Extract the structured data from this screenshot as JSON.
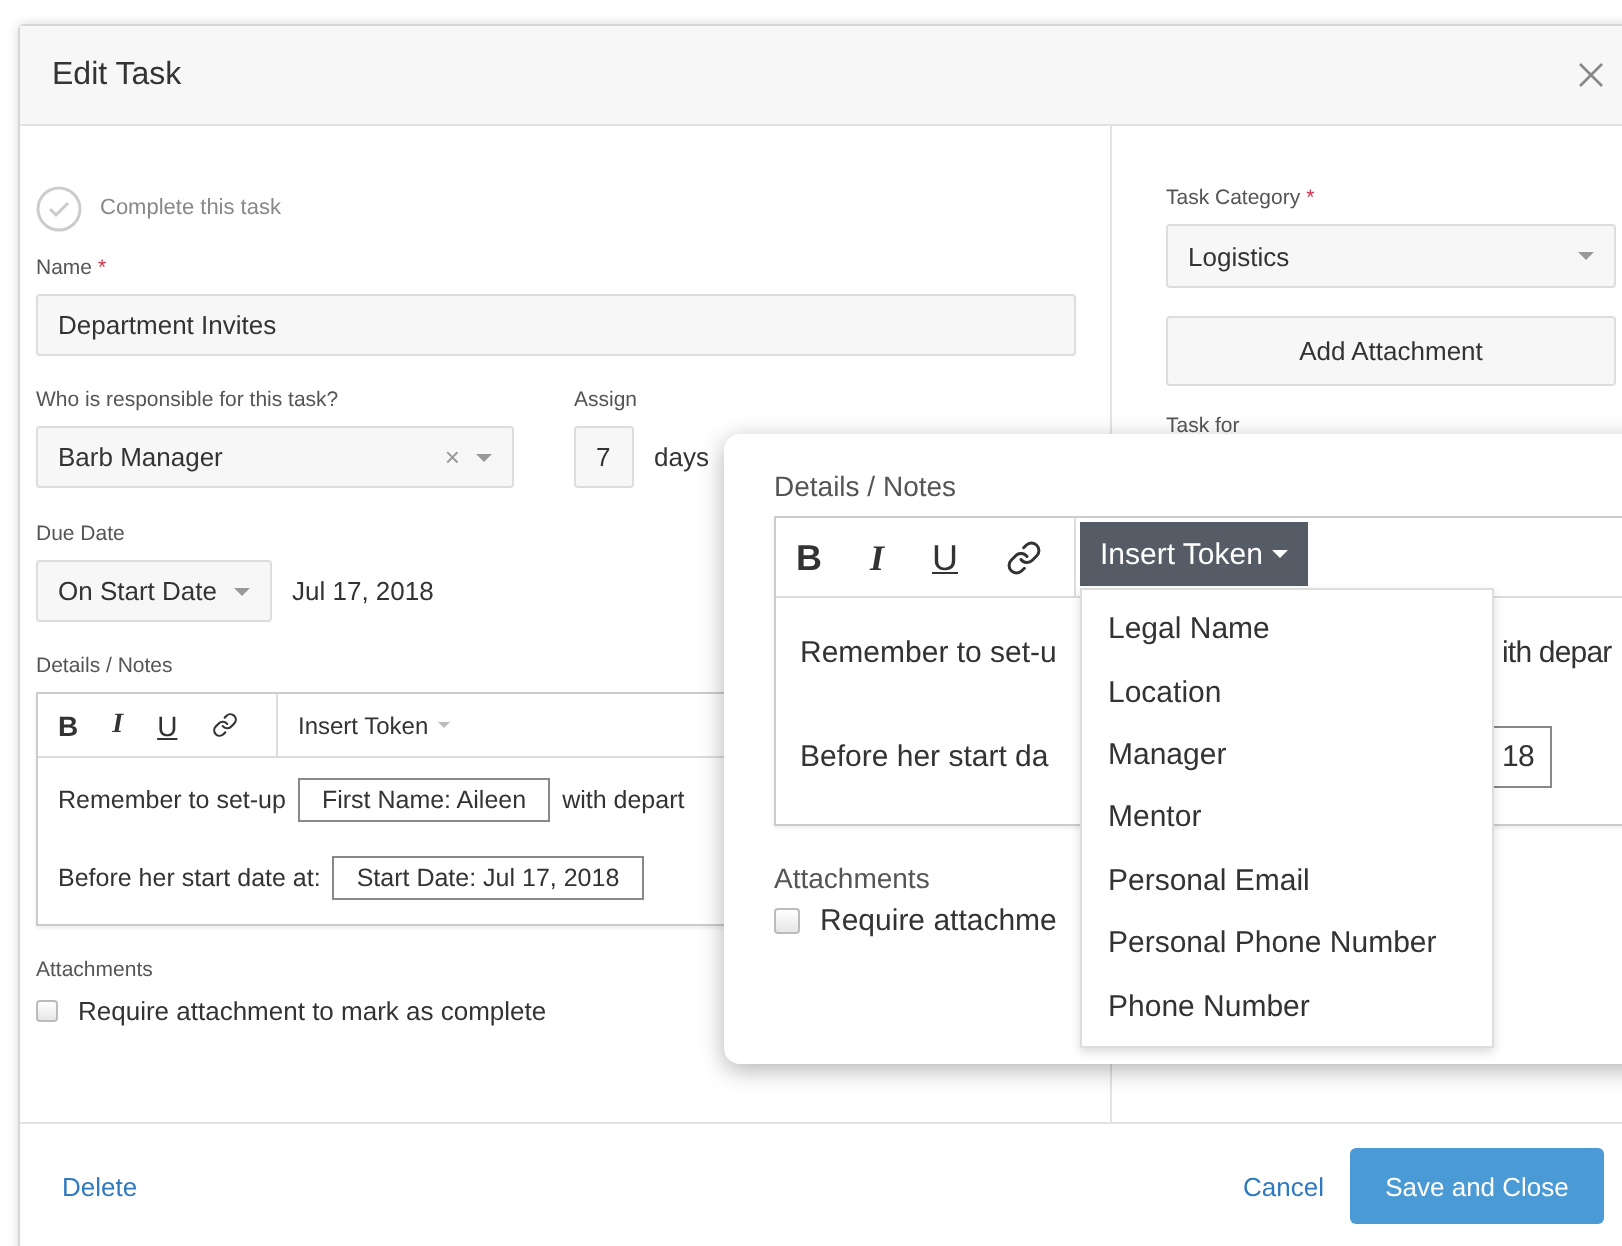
{
  "dialog": {
    "title": "Edit Task"
  },
  "complete": {
    "label": "Complete this task",
    "checked": false
  },
  "name": {
    "label": "Name",
    "required_mark": "*",
    "value": "Department Invites"
  },
  "responsible": {
    "label": "Who is responsible for this task?",
    "value": "Barb Manager",
    "clear": "×"
  },
  "assign": {
    "label": "Assign",
    "value": "7",
    "suffix": "days"
  },
  "due_date": {
    "label": "Due Date",
    "value": "On Start Date",
    "date": "Jul 17, 2018"
  },
  "notes": {
    "label": "Details / Notes",
    "format_buttons": [
      "B",
      "I",
      "U"
    ],
    "insert_token": "Insert Token",
    "lines": [
      {
        "segments": [
          {
            "kind": "text",
            "text": "Remember to set-up"
          },
          {
            "kind": "token",
            "text": "First Name: Aileen"
          },
          {
            "kind": "text",
            "text": "with depart"
          }
        ]
      },
      {
        "segments": [
          {
            "kind": "text",
            "text": "Before her start date at:"
          },
          {
            "kind": "token",
            "text": "Start Date: Jul 17, 2018"
          }
        ]
      }
    ]
  },
  "attachments": {
    "label": "Attachments",
    "require": {
      "label": "Require attachment to mark as complete",
      "checked": false
    }
  },
  "task_category": {
    "label": "Task Category",
    "required_mark": "*",
    "value": "Logistics"
  },
  "add_attachment": "Add Attachment",
  "task_for": {
    "label": "Task for"
  },
  "footer": {
    "delete": "Delete",
    "cancel": "Cancel",
    "save": "Save and Close"
  },
  "zoom_callout": {
    "label": "Details / Notes",
    "format_buttons": [
      "B",
      "I",
      "U"
    ],
    "insert_token": "Insert Token",
    "menu_open": true,
    "menu_items": [
      "Legal Name",
      "Location",
      "Manager",
      "Mentor",
      "Personal Email",
      "Personal Phone Number",
      "Phone Number"
    ],
    "lines": [
      {
        "left": "Remember to set-u",
        "right": {
          "kind": "text",
          "text": "ith depar"
        }
      },
      {
        "left": "Before her start da",
        "right": {
          "kind": "token",
          "text": "18"
        }
      }
    ],
    "attachments_label": "Attachments",
    "require": {
      "label": "Require attachme",
      "checked": false
    }
  }
}
